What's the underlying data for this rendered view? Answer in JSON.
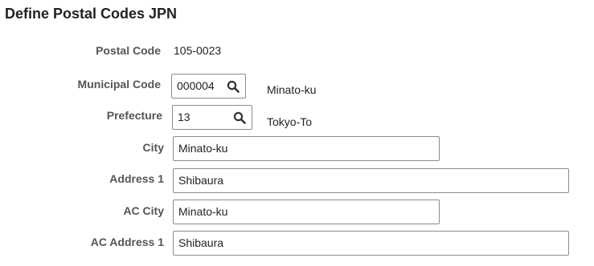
{
  "page": {
    "title": "Define Postal Codes JPN"
  },
  "form": {
    "postal_code": {
      "label": "Postal Code",
      "value": "105-0023"
    },
    "municipal_code": {
      "label": "Municipal Code",
      "value": "000004",
      "description": "Minato-ku",
      "icon": "search-icon"
    },
    "prefecture": {
      "label": "Prefecture",
      "value": "13",
      "description": "Tokyo-To",
      "icon": "search-icon"
    },
    "city": {
      "label": "City",
      "value": "Minato-ku"
    },
    "address1": {
      "label": "Address 1",
      "value": "Shibaura"
    },
    "ac_city": {
      "label": "AC City",
      "value": "Minato-ku"
    },
    "ac_address1": {
      "label": "AC Address 1",
      "value": "Shibaura"
    }
  }
}
